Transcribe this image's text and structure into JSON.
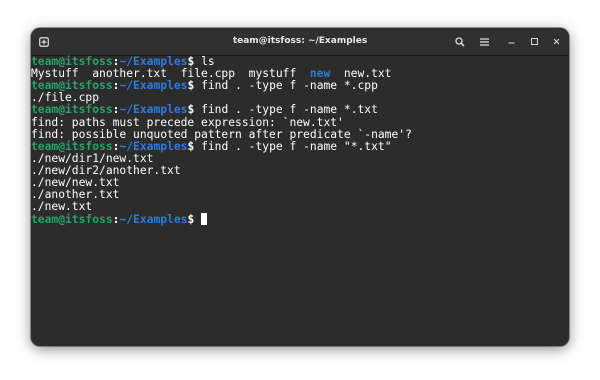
{
  "window": {
    "title": "team@itsfoss: ~/Examples"
  },
  "icons": {
    "new_tab": "new-tab-icon",
    "search": "search-icon",
    "menu": "hamburger-menu-icon",
    "minimize": "minimize-icon",
    "maximize": "maximize-icon",
    "close": "close-icon"
  },
  "prompt": {
    "user_host": "team@itsfoss",
    "separator": ":",
    "path": "~/Examples",
    "dollar": "$"
  },
  "lines": {
    "cmd1": " ls",
    "ls_a": "Mystuff  another.txt  file.cpp  mystuff  ",
    "ls_dir": "new",
    "ls_b": "  new.txt",
    "cmd2": " find . -type f -name *.cpp",
    "out1": "./file.cpp",
    "cmd3": " find . -type f -name *.txt",
    "err1": "find: paths must precede expression: `new.txt'",
    "err2": "find: possible unquoted pattern after predicate `-name'?",
    "cmd4": " find . -type f -name \"*.txt\"",
    "res1": "./new/dir1/new.txt",
    "res2": "./new/dir2/another.txt",
    "res3": "./new/new.txt",
    "res4": "./another.txt",
    "res5": "./new.txt",
    "cmd5": " "
  },
  "colors": {
    "prompt_user": "#26a269",
    "prompt_path": "#2a7bde",
    "directory": "#2a7bde",
    "background": "#2c2c2c",
    "titlebar": "#303030",
    "text": "#ffffff"
  }
}
